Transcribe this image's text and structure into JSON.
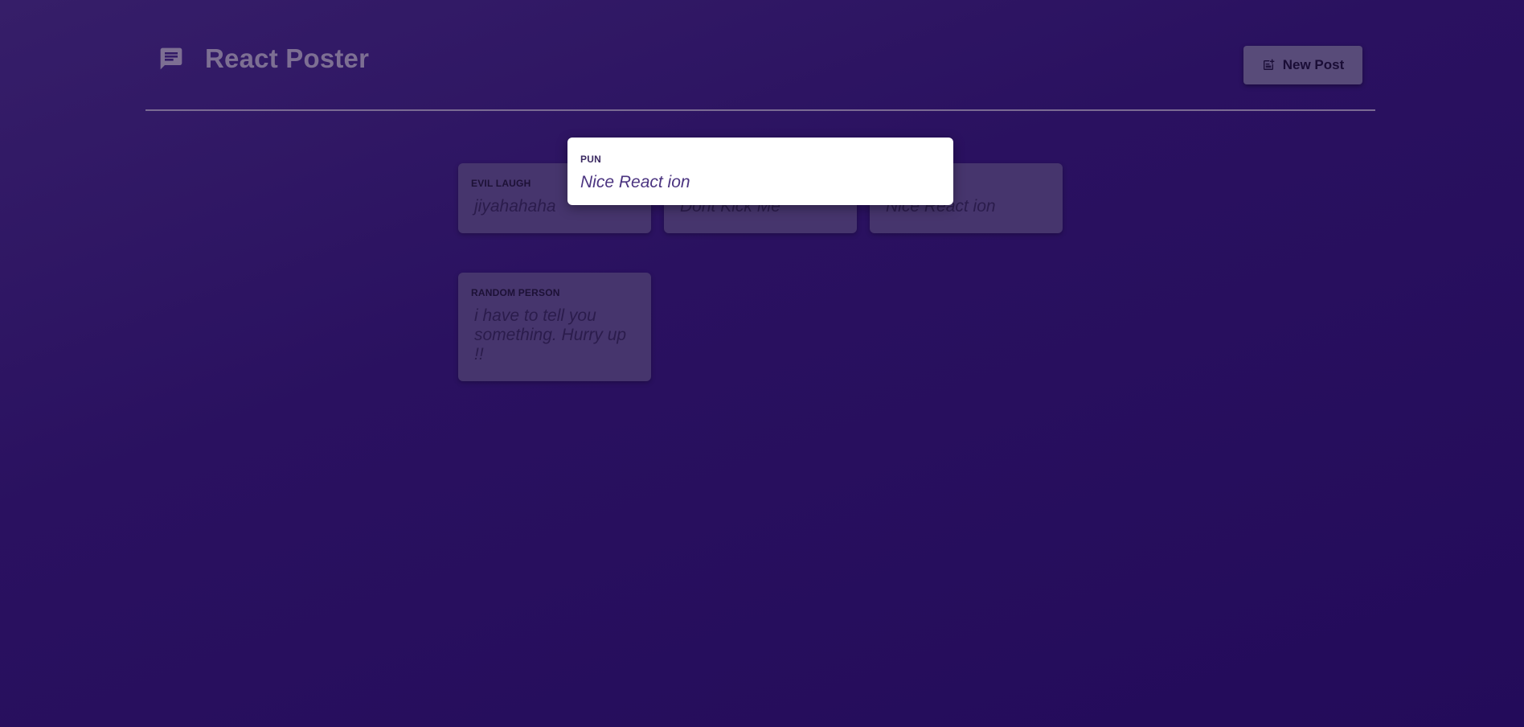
{
  "header": {
    "logo_icon": "chat-message-icon",
    "title": "React Poster",
    "new_post_button": {
      "label": "New Post",
      "icon": "new-post-icon"
    }
  },
  "posts": [
    {
      "author": "Evil Laugh",
      "body": "jiyahahaha"
    },
    {
      "author": "",
      "body": "Dont Kick Me"
    },
    {
      "author": "",
      "body": "Nice React ion"
    },
    {
      "author": "Random Person",
      "body": "i have to tell you something. Hurry up !!"
    }
  ],
  "modal": {
    "author": "Pun",
    "body": "Nice React ion"
  },
  "colors": {
    "background_top": "#361e69",
    "background_bottom": "#230b5a",
    "card": "#46356d",
    "button": "#584b79",
    "modal_bg": "#ffffff",
    "modal_text": "#4b3480"
  }
}
